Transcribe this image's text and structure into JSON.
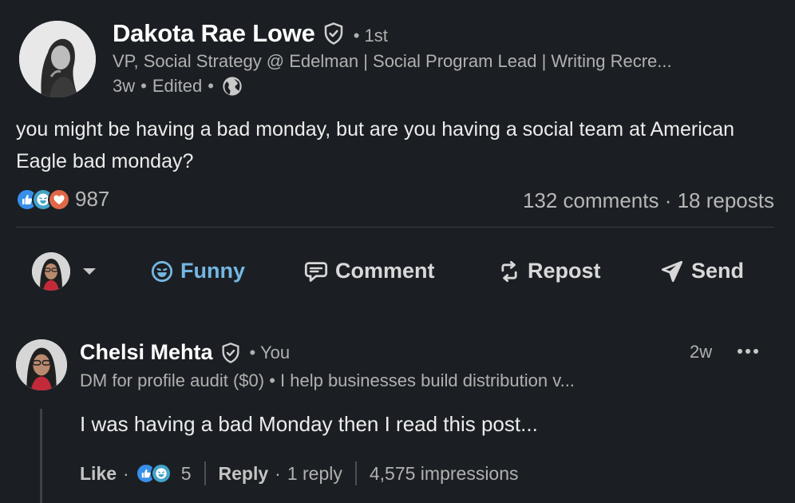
{
  "post": {
    "author_name": "Dakota Rae Lowe",
    "connection_degree": "• 1st",
    "headline": "VP, Social Strategy @ Edelman | Social Program Lead | Writing Recre...",
    "age": "3w",
    "edited": "Edited",
    "visibility_icon": "globe-icon",
    "body": "you might be having a bad monday, but are you having a social team at American Eagle bad monday?",
    "reaction_count": "987",
    "reaction_icons": [
      "like-reaction-icon",
      "funny-reaction-icon",
      "love-reaction-icon"
    ],
    "comments_reposts": "132 comments · 18 reposts"
  },
  "actions": {
    "funny_label": "Funny",
    "comment_label": "Comment",
    "repost_label": "Repost",
    "send_label": "Send"
  },
  "comment": {
    "author_name": "Chelsi Mehta",
    "relation": "• You",
    "age": "2w",
    "headline": "DM for profile audit ($0) • I help businesses build distribution v...",
    "text": "I was having a bad Monday then I read this post...",
    "like_label": "Like",
    "reaction_count": "5",
    "reply_label": "Reply",
    "reply_count": "1 reply",
    "impressions": "4,575 impressions"
  },
  "colors": {
    "background": "#1b1f23",
    "funny_accent": "#74b7e3",
    "like_blue": "#378fe9",
    "funny_teal": "#44a3c8",
    "love_orange": "#e06847"
  }
}
